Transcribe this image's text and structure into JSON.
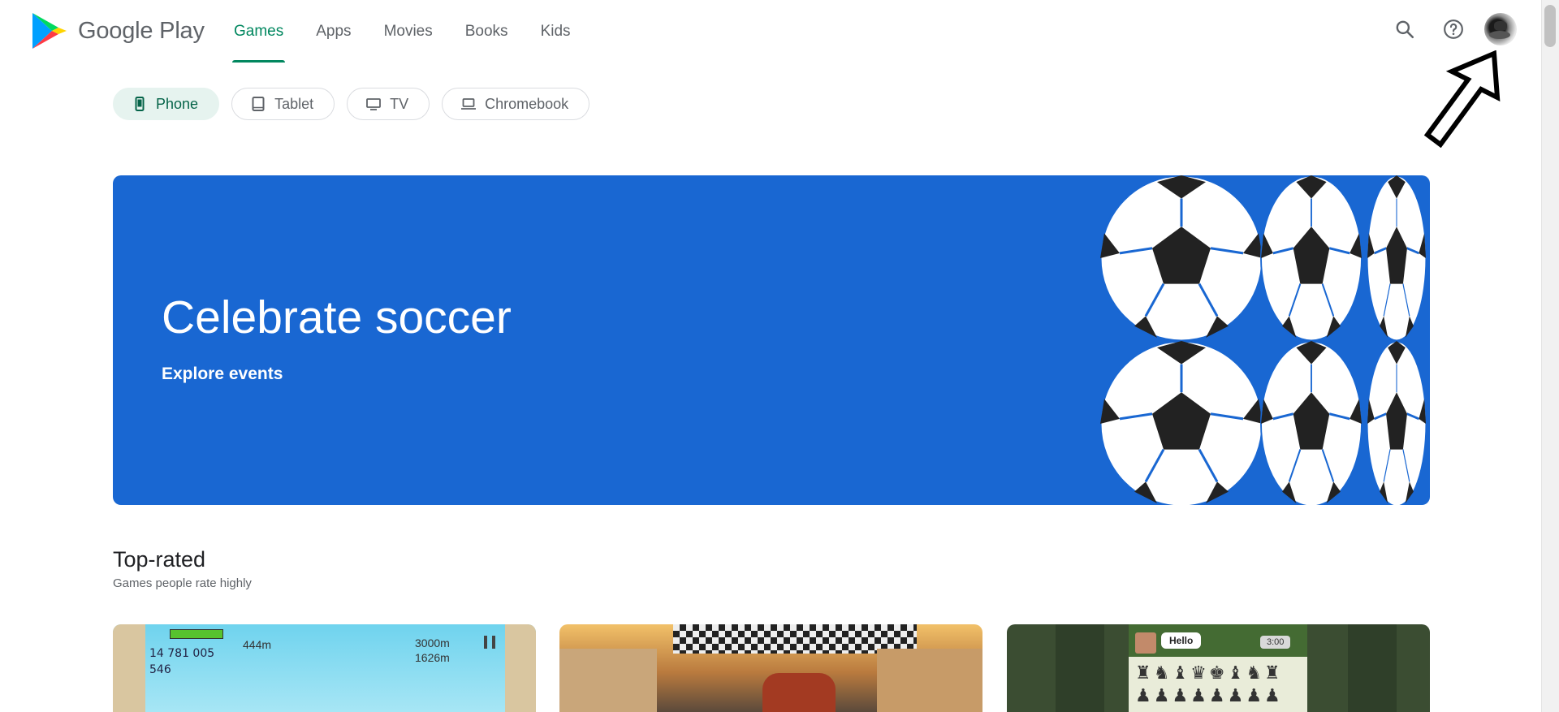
{
  "header": {
    "brand": "Google Play",
    "tabs": [
      {
        "label": "Games",
        "active": true
      },
      {
        "label": "Apps",
        "active": false
      },
      {
        "label": "Movies",
        "active": false
      },
      {
        "label": "Books",
        "active": false
      },
      {
        "label": "Kids",
        "active": false
      }
    ],
    "icons": [
      "search-icon",
      "help-icon",
      "account-avatar"
    ]
  },
  "devices": [
    {
      "label": "Phone",
      "icon": "phone-icon",
      "active": true
    },
    {
      "label": "Tablet",
      "icon": "tablet-icon",
      "active": false
    },
    {
      "label": "TV",
      "icon": "tv-icon",
      "active": false
    },
    {
      "label": "Chromebook",
      "icon": "laptop-icon",
      "active": false
    }
  ],
  "banner": {
    "title": "Celebrate soccer",
    "subtitle": "Explore events",
    "color": "#1967d2"
  },
  "section": {
    "title": "Top-rated",
    "subtitle": "Games people rate highly"
  },
  "cards": [
    {
      "hud_coins": "14 781 005",
      "hud_gems": "546",
      "distance": "444m",
      "best": "3000m",
      "record": "1626m"
    },
    {},
    {
      "chat": "Hello",
      "timer": "3:00"
    }
  ],
  "colors": {
    "accent": "#01875f",
    "chip_active_bg": "#e6f3ef",
    "text_secondary": "#5f6368"
  }
}
